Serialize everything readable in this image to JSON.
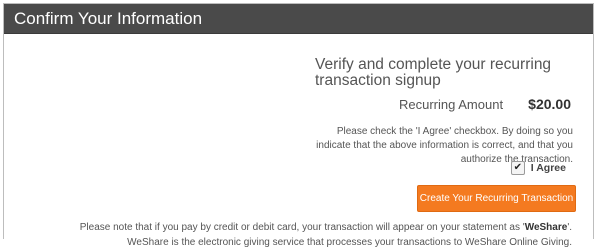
{
  "panel": {
    "title": "Confirm Your Information"
  },
  "summary": {
    "heading": "Verify and complete your recurring transaction signup",
    "amount_label": "Recurring Amount",
    "amount_value": "$20.00"
  },
  "agreement": {
    "instructions": "Please check the 'I Agree' checkbox. By doing so you indicate that the above information is correct, and that you authorize the transaction.",
    "checkbox_label": "I Agree",
    "checked": true
  },
  "actions": {
    "submit_label": "Create Your Recurring Transaction"
  },
  "notice": {
    "part1": "Please note that if you pay by credit or debit card, your transaction will appear on your statement as '",
    "brand": "WeShare",
    "part2": "'. WeShare is the electronic giving service that processes your transactions to WeShare Online Giving."
  },
  "colors": {
    "header_bg": "#4a4a4a",
    "accent": "#f47a20"
  }
}
